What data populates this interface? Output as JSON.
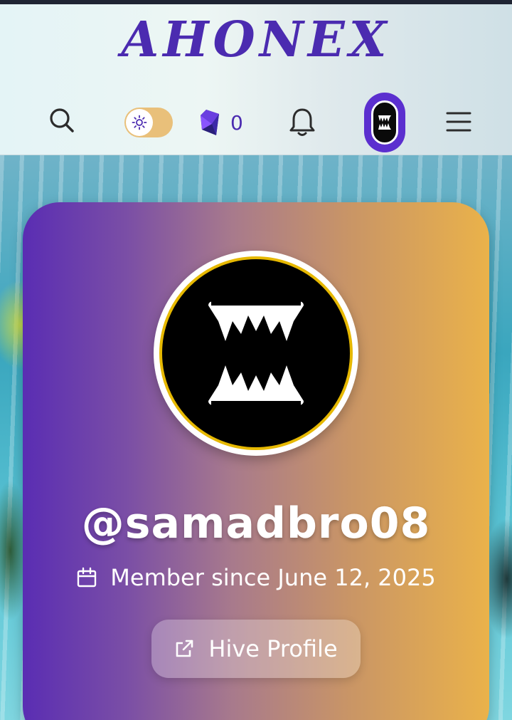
{
  "header": {
    "logo_text": "AHONEX",
    "gem_count": "0",
    "icons": [
      "search-icon",
      "sun-icon",
      "gem-icon",
      "bell-icon",
      "menu-icon"
    ]
  },
  "profile": {
    "username": "@samadbro08",
    "member_since": "Member since June 12, 2025",
    "hive_button_label": "Hive Profile"
  },
  "colors": {
    "brand_purple": "#4b2bb0",
    "toggle": "#e9c07a",
    "card_start": "#5a2db3",
    "card_end": "#eab24a",
    "ring": "#e6b800"
  }
}
